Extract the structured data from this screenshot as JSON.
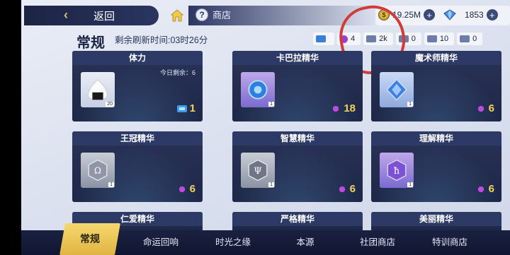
{
  "header": {
    "back_label": "返回",
    "shop_label": "商店",
    "resources": [
      {
        "icon": "gold-coin-icon",
        "value": "19.25M"
      },
      {
        "icon": "crystal-gem-icon",
        "value": "1853"
      }
    ]
  },
  "section": {
    "title": "常规",
    "refresh_text": "剩余刷新时间:03时26分"
  },
  "tokens": [
    {
      "icon": "ticket-blue-icon",
      "value": ""
    },
    {
      "icon": "purple-orb-icon",
      "value": "4"
    },
    {
      "icon": "ticket-icon",
      "value": "2k"
    },
    {
      "icon": "ticket-icon",
      "value": "0"
    },
    {
      "icon": "ticket-icon",
      "value": "10"
    },
    {
      "icon": "ticket-icon",
      "value": "0"
    }
  ],
  "cards": [
    {
      "name": "体力",
      "remain": "今日剩余：6",
      "qty": "20",
      "price": "1",
      "currency": "ticket-blue-icon",
      "thumb": "rice-ball-icon"
    },
    {
      "name": "卡巴拉精华",
      "remain": "",
      "qty": "1",
      "price": "18",
      "currency": "purple-orb-icon",
      "thumb": "kabbalah-essence-icon"
    },
    {
      "name": "魔术师精华",
      "remain": "",
      "qty": "1",
      "price": "6",
      "currency": "purple-orb-icon",
      "thumb": "magician-essence-icon"
    },
    {
      "name": "王冠精华",
      "remain": "",
      "qty": "1",
      "price": "6",
      "currency": "purple-orb-icon",
      "thumb": "crown-essence-icon"
    },
    {
      "name": "智慧精华",
      "remain": "",
      "qty": "1",
      "price": "6",
      "currency": "purple-orb-icon",
      "thumb": "wisdom-essence-icon"
    },
    {
      "name": "理解精华",
      "remain": "",
      "qty": "1",
      "price": "6",
      "currency": "purple-orb-icon",
      "thumb": "understanding-essence-icon"
    },
    {
      "name": "仁爱精华"
    },
    {
      "name": "严格精华"
    },
    {
      "name": "美丽精华"
    }
  ],
  "tabs": [
    "常规",
    "命运回响",
    "时光之缘",
    "本源",
    "社团商店",
    "特训商店"
  ],
  "colors": {
    "accent": "#f2d25c",
    "annotation": "#d23b3b",
    "card_bg": "#1e2747"
  }
}
